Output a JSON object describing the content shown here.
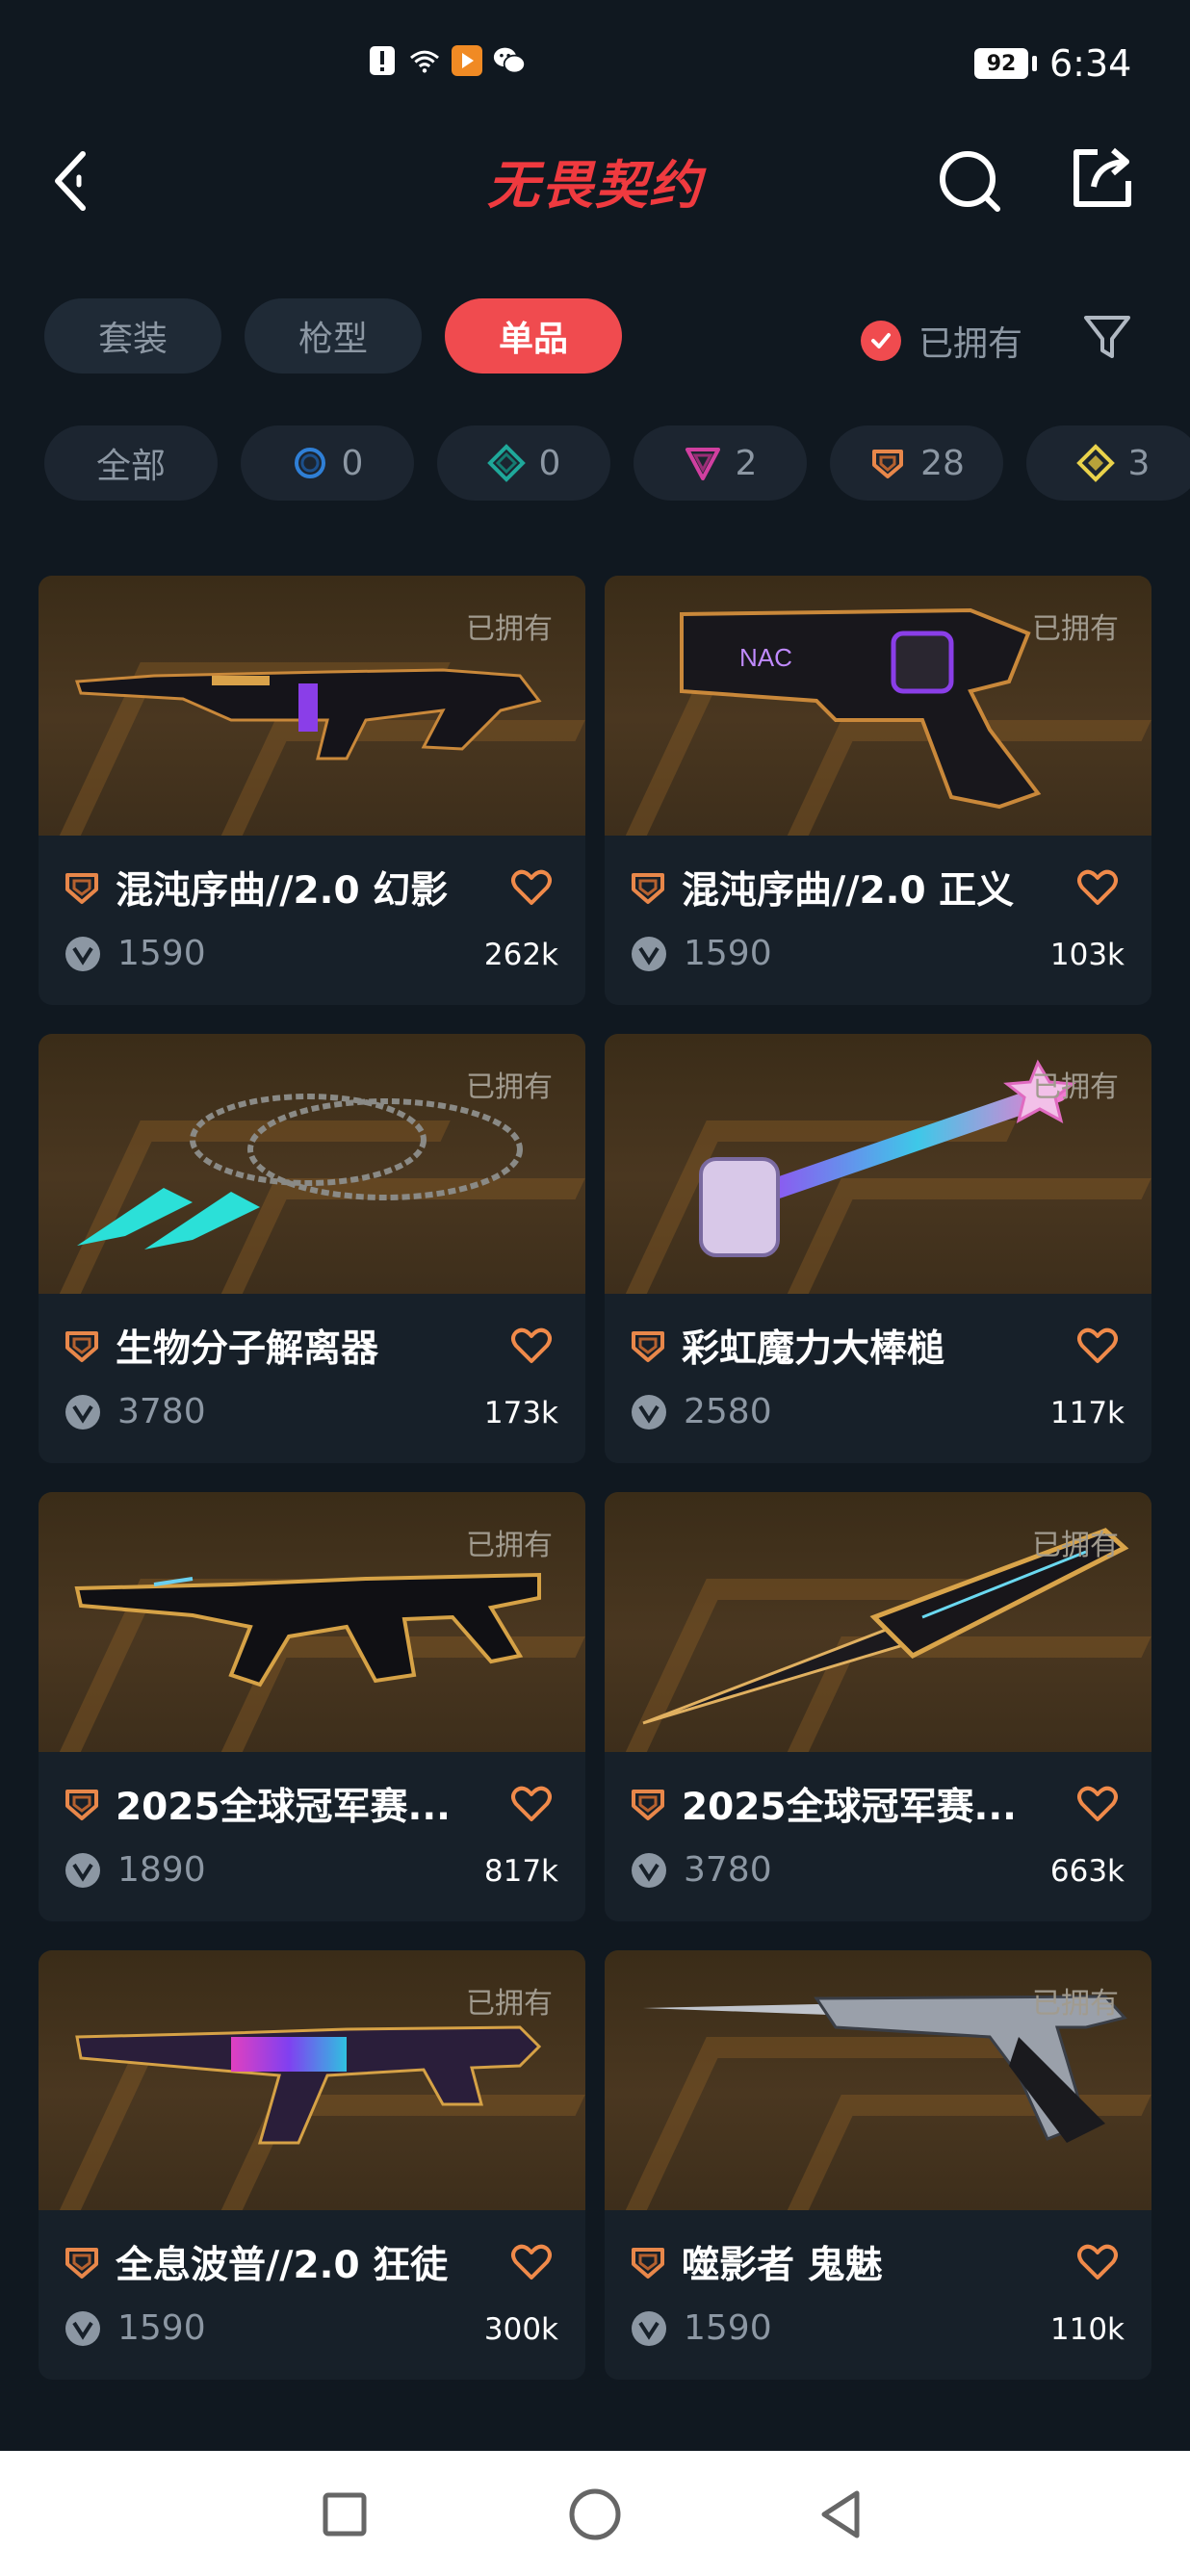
{
  "status_bar": {
    "time": "6:34",
    "battery": "92",
    "icons": [
      "alert-icon",
      "wifi-icon",
      "app-notification-icon",
      "wechat-icon"
    ]
  },
  "header": {
    "title": "无畏契约",
    "back_icon": "back-arrow-icon",
    "search_icon": "search-icon",
    "share_icon": "share-icon"
  },
  "category_tabs": [
    {
      "label": "套装",
      "active": false
    },
    {
      "label": "枪型",
      "active": false
    },
    {
      "label": "单品",
      "active": true
    }
  ],
  "owned_filter": {
    "label": "已拥有",
    "checked": true
  },
  "filter_icon": "funnel-filter-icon",
  "tier_filters": [
    {
      "label": "全部",
      "count": "",
      "icon": ""
    },
    {
      "label": "",
      "count": "0",
      "icon": "select-tier-icon",
      "color": "#2f7fd6"
    },
    {
      "label": "",
      "count": "0",
      "icon": "deluxe-tier-icon",
      "color": "#1fa89a"
    },
    {
      "label": "",
      "count": "2",
      "icon": "premium-tier-icon",
      "color": "#d13fa0"
    },
    {
      "label": "",
      "count": "28",
      "icon": "exclusive-tier-icon",
      "color": "#e8874a"
    },
    {
      "label": "",
      "count": "3",
      "icon": "ultra-tier-icon",
      "color": "#e9d24b"
    }
  ],
  "items": [
    {
      "name": "混沌序曲//2.0 幻影",
      "price": "1590",
      "likes": "262k",
      "owned_label": "已拥有",
      "weapon": "rifle"
    },
    {
      "name": "混沌序曲//2.0 正义",
      "price": "1590",
      "likes": "103k",
      "owned_label": "已拥有",
      "weapon": "pistol"
    },
    {
      "name": "生物分子解离器",
      "price": "3780",
      "likes": "173k",
      "owned_label": "已拥有",
      "weapon": "darts"
    },
    {
      "name": "彩虹魔力大棒槌",
      "price": "2580",
      "likes": "117k",
      "owned_label": "已拥有",
      "weapon": "hammer"
    },
    {
      "name": "2025全球冠军赛...",
      "price": "1890",
      "likes": "817k",
      "owned_label": "已拥有",
      "weapon": "ak"
    },
    {
      "name": "2025全球冠军赛...",
      "price": "3780",
      "likes": "663k",
      "owned_label": "已拥有",
      "weapon": "knife"
    },
    {
      "name": "全息波普//2.0 狂徒",
      "price": "1590",
      "likes": "300k",
      "owned_label": "已拥有",
      "weapon": "vandal"
    },
    {
      "name": "噬影者 鬼魅",
      "price": "1590",
      "likes": "110k",
      "owned_label": "已拥有",
      "weapon": "ghost"
    }
  ],
  "colors": {
    "accent": "#f04b4f",
    "background": "#101820",
    "card": "#172029",
    "tier_exclusive": "#e8874a"
  }
}
